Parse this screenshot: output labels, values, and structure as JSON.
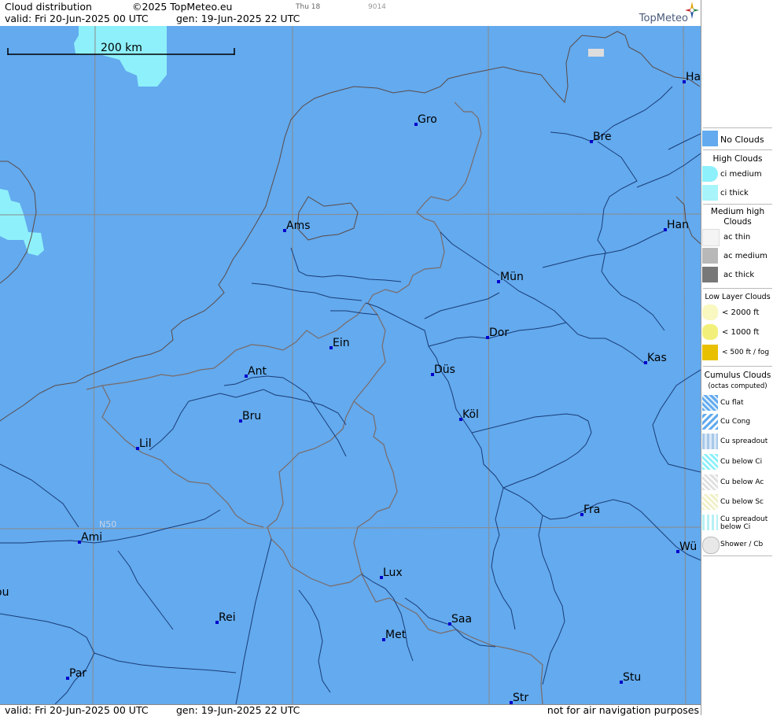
{
  "header": {
    "title": "Cloud distribution",
    "copyright": "©2025 TopMeteo.eu",
    "valid": "valid:  Fri  20-Jun-2025  00 UTC",
    "generated": "gen: 19-Jun-2025 22 UTC",
    "small_day": "Thu 18",
    "small_code": "9014",
    "logo": "TopMeteo"
  },
  "footer": {
    "valid": "valid:  Fri  20-Jun-2025  00 UTC",
    "generated": "gen: 19-Jun-2025 22 UTC",
    "note": "not for air navigation purposes"
  },
  "map": {
    "scale_label": "200 km",
    "grid_label": "N50",
    "colors": {
      "no_clouds": "#63aaee",
      "ci_thick": "#8ef0fa",
      "borders": "#7a6a68",
      "rivers": "#1a3c78",
      "grid": "#8a8a8a",
      "city_marker": "#0000cc"
    },
    "cities": [
      {
        "name": "Ha"
      },
      {
        "name": "Gro"
      },
      {
        "name": "Bre"
      },
      {
        "name": "Ams"
      },
      {
        "name": "Han"
      },
      {
        "name": "Mün"
      },
      {
        "name": "Dor"
      },
      {
        "name": "Ein"
      },
      {
        "name": "Kas"
      },
      {
        "name": "Ant"
      },
      {
        "name": "Düs"
      },
      {
        "name": "Bru"
      },
      {
        "name": "Köl"
      },
      {
        "name": "Lil"
      },
      {
        "name": "Fra"
      },
      {
        "name": "Ami"
      },
      {
        "name": "Wü"
      },
      {
        "name": "Lux"
      },
      {
        "name": "ou"
      },
      {
        "name": "Rei"
      },
      {
        "name": "Saa"
      },
      {
        "name": "Met"
      },
      {
        "name": "Par"
      },
      {
        "name": "Stu"
      },
      {
        "name": "Str"
      }
    ]
  },
  "legend": {
    "no_clouds": "No Clouds",
    "high_head": "High Clouds",
    "ci_medium": "ci medium",
    "ci_thick": "ci thick",
    "medium_head_1": "Medium high",
    "medium_head_2": "Clouds",
    "ac_thin": "ac thin",
    "ac_medium": "ac medium",
    "ac_thick": "ac thick",
    "low_head": "Low Layer Clouds",
    "low_2000": "< 2000 ft",
    "low_1000": "< 1000 ft",
    "low_500": "< 500 ft / fog",
    "cu_head_1": "Cumulus Clouds",
    "cu_head_2": "(octas computed)",
    "cu_flat": "Cu flat",
    "cu_cong": "Cu Cong",
    "cu_spreadout": "Cu spreadout",
    "cu_below_ci": "Cu below Ci",
    "cu_below_ac": "Cu below Ac",
    "cu_below_sc": "Cu below Sc",
    "cu_spread_ci_1": "Cu spreadout",
    "cu_spread_ci_2": "below Ci",
    "shower": "Shower / Cb"
  }
}
